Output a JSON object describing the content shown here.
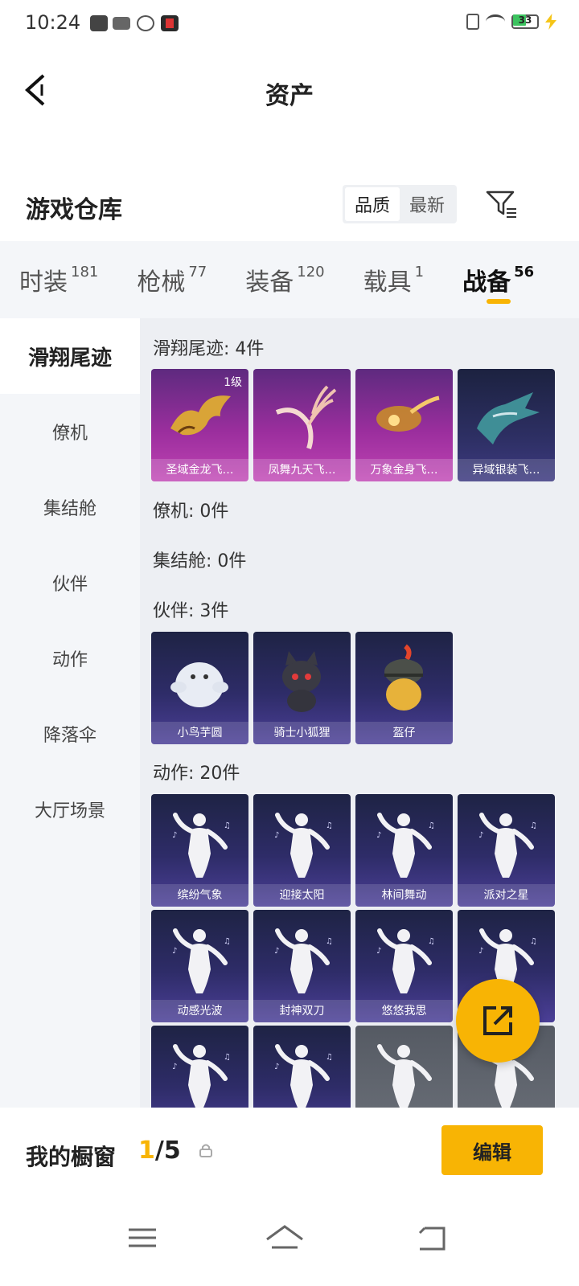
{
  "status_bar": {
    "time": "10:24",
    "battery": "33",
    "icons": [
      "video-app-icon",
      "vivo-icon",
      "link-icon",
      "game-icon",
      "no-sim-icon",
      "wifi-icon",
      "battery-icon",
      "charging-icon"
    ]
  },
  "header": {
    "title": "资产",
    "back_icon": "chevron-left-icon"
  },
  "warehouse": {
    "title": "游戏仓库",
    "sort_options": [
      "品质",
      "最新"
    ],
    "sort_selected": "品质",
    "filter_icon": "filter-icon"
  },
  "tabs": [
    {
      "label": "时装",
      "count": "181",
      "active": false
    },
    {
      "label": "枪械",
      "count": "77",
      "active": false
    },
    {
      "label": "装备",
      "count": "120",
      "active": false
    },
    {
      "label": "载具",
      "count": "1",
      "active": false
    },
    {
      "label": "战备",
      "count": "56",
      "active": true
    }
  ],
  "sidebar": {
    "items": [
      "滑翔尾迹",
      "僚机",
      "集结舱",
      "伙伴",
      "动作",
      "降落伞",
      "大厅场景"
    ],
    "active": "滑翔尾迹"
  },
  "sections": {
    "glide_trail": {
      "title": "滑翔尾迹: 4件",
      "items": [
        {
          "name": "圣域金龙飞…",
          "level": "1级",
          "icon": "golden-dragon-icon"
        },
        {
          "name": "凤舞九天飞…",
          "icon": "phoenix-wings-icon"
        },
        {
          "name": "万象金身飞…",
          "icon": "golden-comet-icon"
        },
        {
          "name": "异域银装飞…",
          "icon": "silver-wings-icon"
        }
      ]
    },
    "wingman": {
      "title": "僚机: 0件"
    },
    "assembly_pod": {
      "title": "集结舱: 0件"
    },
    "companion": {
      "title": "伙伴: 3件",
      "items": [
        {
          "name": "小鸟芋圆",
          "icon": "white-bird-icon"
        },
        {
          "name": "骑士小狐狸",
          "icon": "knight-fox-icon"
        },
        {
          "name": "盔仔",
          "icon": "helmet-chick-icon"
        }
      ]
    },
    "emote": {
      "title": "动作: 20件",
      "items": [
        {
          "name": "缤纷气象",
          "icon": "dancer-icon"
        },
        {
          "name": "迎接太阳",
          "icon": "dancer-icon"
        },
        {
          "name": "林间舞动",
          "icon": "dancer-icon"
        },
        {
          "name": "派对之星",
          "icon": "dancer-icon"
        },
        {
          "name": "动感光波",
          "icon": "dancer-icon"
        },
        {
          "name": "封神双刀",
          "icon": "dancer-icon"
        },
        {
          "name": "悠悠我思",
          "icon": "dancer-icon"
        },
        {
          "name": "",
          "icon": "dancer-icon"
        },
        {
          "name": "",
          "icon": "dancer-icon"
        },
        {
          "name": "",
          "icon": "dancer-icon"
        },
        {
          "name": "",
          "icon": "dancer-icon"
        },
        {
          "name": "",
          "icon": "dancer-icon"
        }
      ]
    }
  },
  "share_button": {
    "icon": "share-external-icon"
  },
  "showcase": {
    "label": "我的橱窗",
    "current": "1",
    "total": "/5",
    "edit_label": "编辑"
  },
  "nav_bar": {
    "icons": [
      "menu-icon",
      "home-icon",
      "back-nav-icon"
    ]
  },
  "colors": {
    "accent": "#f8b404",
    "rare_card": "#9a2e9d",
    "epic_card": "#2d2f63"
  }
}
